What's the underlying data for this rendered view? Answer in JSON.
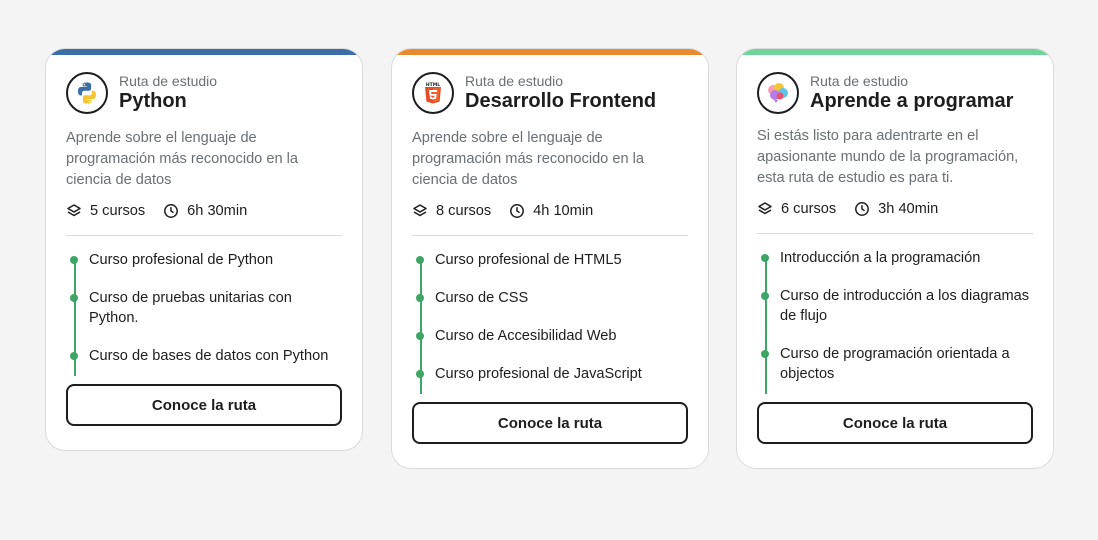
{
  "cards": [
    {
      "accent": "#3b6ea5",
      "icon": "python-logo-icon",
      "eyebrow": "Ruta de estudio",
      "title": "Python",
      "description": "Aprende sobre el lenguaje de programación más reconocido en la ciencia de datos",
      "courses": "5 cursos",
      "duration": "6h 30min",
      "items": [
        "Curso profesional de Python",
        "Curso de pruebas unitarias con Python.",
        "Curso de bases de datos con Python"
      ],
      "button": "Conoce la ruta"
    },
    {
      "accent": "#e98a2f",
      "icon": "html5-logo-icon",
      "eyebrow": "Ruta de estudio",
      "title": "Desarrollo Frontend",
      "description": "Aprende sobre el lenguaje de programación más reconocido en la ciencia de datos",
      "courses": "8 cursos",
      "duration": "4h 10min",
      "items": [
        "Curso profesional de HTML5",
        "Curso de CSS",
        "Curso de Accesibilidad Web",
        "Curso profesional de JavaScript"
      ],
      "button": "Conoce la ruta"
    },
    {
      "accent": "#6fd49a",
      "icon": "brain-icon",
      "eyebrow": "Ruta de estudio",
      "title": "Aprende a programar",
      "description": "Si estás listo para adentrarte en el apasionante mundo de la programación, esta ruta de estudio es para ti.",
      "courses": "6 cursos",
      "duration": "3h 40min",
      "items": [
        "Introducción a la programación",
        "Curso de introducción a los diagramas de flujo",
        "Curso de programación orientada a objectos"
      ],
      "button": "Conoce la ruta"
    }
  ]
}
